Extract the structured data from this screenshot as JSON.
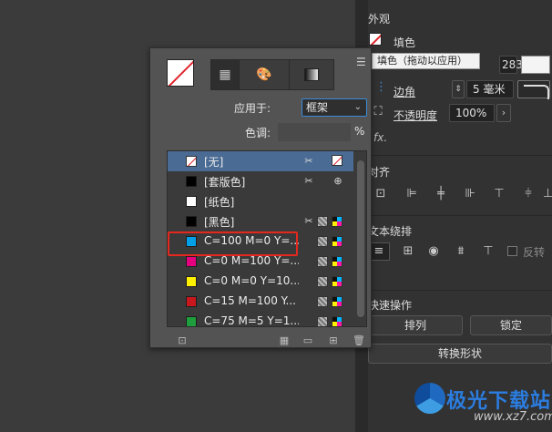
{
  "properties": {
    "appearance_title": "外观",
    "fill_label": "填色",
    "tooltip": "填色（拖动以应用）",
    "stroke_value": "283",
    "corner_label": "边角",
    "corner_value": "5 毫米",
    "opacity_label": "不透明度",
    "opacity_value": "100%",
    "fx_label": "fx.",
    "align_title": "对齐",
    "wrap_title": "文本绕排",
    "reverse_label": "反转",
    "quick_title": "快速操作",
    "arrange_button": "排列",
    "lock_button": "锁定",
    "convert_button": "转换形状"
  },
  "swatches": {
    "apply_label": "应用于:",
    "apply_value": "框架",
    "tint_label": "色调:",
    "tint_value": "",
    "pct": "%",
    "items": [
      {
        "name": "[无]",
        "color": "none",
        "selected": true,
        "icons": [
          "x-edit",
          "none-box"
        ]
      },
      {
        "name": "[套版色]",
        "color": "#000000",
        "selected": false,
        "icons": [
          "x-edit",
          "registration"
        ]
      },
      {
        "name": "[纸色]",
        "color": "#ffffff",
        "selected": false,
        "icons": []
      },
      {
        "name": "[黑色]",
        "color": "#000000",
        "selected": false,
        "icons": [
          "x-edit",
          "spot",
          "cmyk"
        ]
      },
      {
        "name": "C=100 M=0 Y=...",
        "color": "#00a0e9",
        "selected": false,
        "icons": [
          "spot",
          "cmyk"
        ]
      },
      {
        "name": "C=0 M=100 Y=...",
        "color": "#e4007f",
        "selected": false,
        "icons": [
          "spot",
          "cmyk"
        ]
      },
      {
        "name": "C=0 M=0 Y=10...",
        "color": "#fff100",
        "selected": false,
        "icons": [
          "spot",
          "cmyk"
        ]
      },
      {
        "name": "C=15 M=100 Y...",
        "color": "#c9171e",
        "selected": false,
        "icons": [
          "spot",
          "cmyk"
        ]
      },
      {
        "name": "C=75 M=5 Y=1...",
        "color": "#1e9e3c",
        "selected": false,
        "icons": [
          "spot",
          "cmyk"
        ]
      }
    ]
  },
  "watermark": {
    "text": "极光下载站",
    "url": "www.xz7.com"
  }
}
